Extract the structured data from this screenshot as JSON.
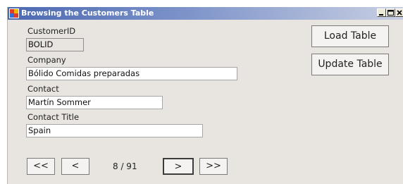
{
  "window": {
    "title": "Browsing the Customers Table",
    "icons": [
      "app-icon",
      "minimize-icon",
      "maximize-icon",
      "close-icon"
    ]
  },
  "form": {
    "customer_id": {
      "label": "CustomerID",
      "value": "BOLID"
    },
    "company": {
      "label": "Company",
      "value": "Bólido Comidas preparadas"
    },
    "contact": {
      "label": "Contact",
      "value": "Martín Sommer"
    },
    "contact_title": {
      "label": "Contact Title",
      "value": "Spain"
    }
  },
  "actions": {
    "load_table": "Load Table",
    "update_table": "Update Table"
  },
  "navigation": {
    "first": "<<",
    "previous": "<",
    "next": ">",
    "last": ">>",
    "position": "8 /  91"
  },
  "colors": {
    "window_background": "#e8e4df",
    "titlebar_start": "#4b68b2",
    "titlebar_end": "#c8cfe2"
  }
}
